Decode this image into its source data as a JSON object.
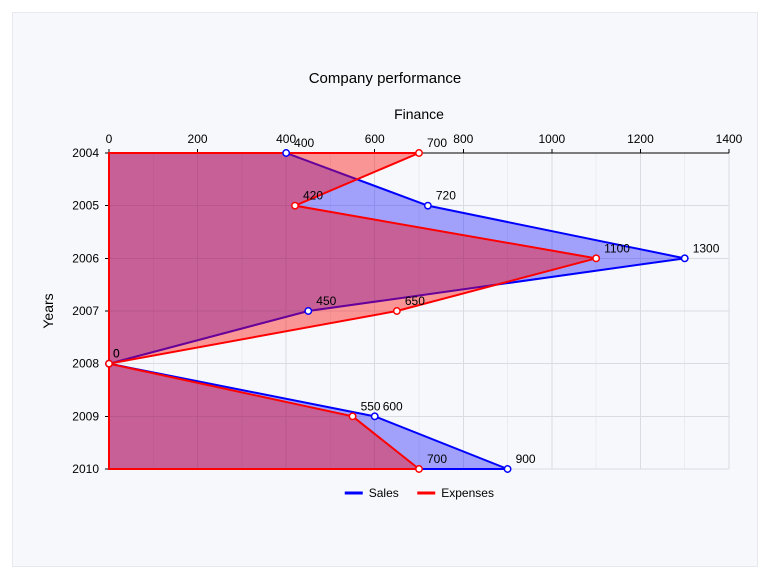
{
  "chart_data": {
    "type": "area",
    "title": "Company performance",
    "xlabel": "Finance",
    "ylabel": "Years",
    "x_ticks": [
      0,
      200,
      400,
      600,
      800,
      1000,
      1200,
      1400
    ],
    "y_categories": [
      2004,
      2005,
      2006,
      2007,
      2008,
      2009,
      2010
    ],
    "xlim": [
      0,
      1400
    ],
    "series": [
      {
        "name": "Sales",
        "color": "#0000ff",
        "values": [
          400,
          720,
          1300,
          450,
          0,
          600,
          900
        ]
      },
      {
        "name": "Expenses",
        "color": "#ff0000",
        "values": [
          700,
          420,
          1100,
          650,
          0,
          550,
          700
        ]
      }
    ],
    "legend": {
      "position": "bottom"
    }
  }
}
